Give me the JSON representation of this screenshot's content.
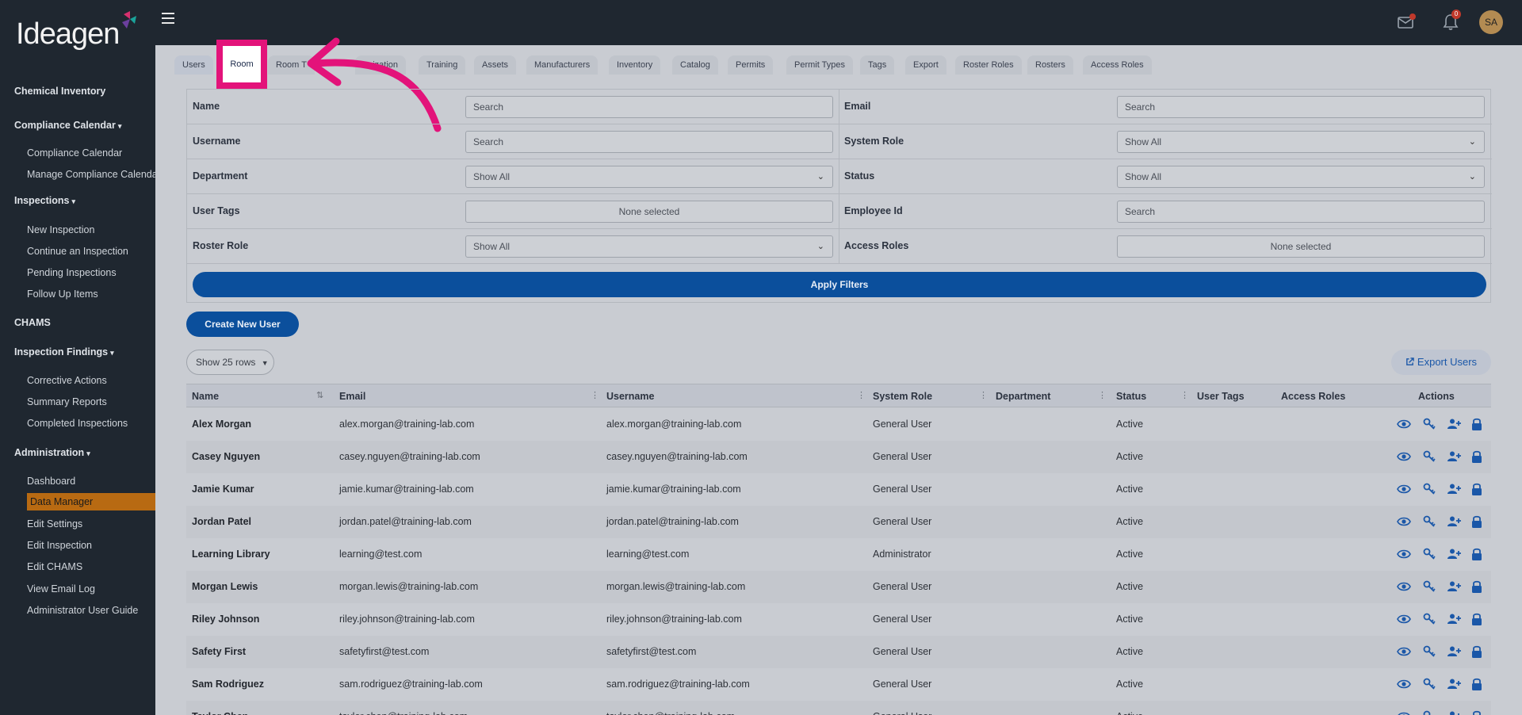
{
  "app": {
    "logo_text": "Ideagen",
    "avatar_initials": "SA",
    "notification_count": "0"
  },
  "sidebar": {
    "items": [
      {
        "label": "Chemical Inventory",
        "type": "section"
      },
      {
        "label": "Compliance Calendar",
        "type": "section",
        "caret": true
      },
      {
        "label": "Compliance Calendar",
        "type": "sub"
      },
      {
        "label": "Manage Compliance Calendar",
        "type": "sub"
      },
      {
        "label": "Inspections",
        "type": "section",
        "caret": true
      },
      {
        "label": "New Inspection",
        "type": "sub"
      },
      {
        "label": "Continue an Inspection",
        "type": "sub"
      },
      {
        "label": "Pending Inspections",
        "type": "sub"
      },
      {
        "label": "Follow Up Items",
        "type": "sub"
      },
      {
        "label": "CHAMS",
        "type": "section"
      },
      {
        "label": "Inspection Findings",
        "type": "section",
        "caret": true
      },
      {
        "label": "Corrective Actions",
        "type": "sub"
      },
      {
        "label": "Summary Reports",
        "type": "sub"
      },
      {
        "label": "Completed Inspections",
        "type": "sub"
      },
      {
        "label": "Administration",
        "type": "section",
        "caret": true
      },
      {
        "label": "Dashboard",
        "type": "sub"
      },
      {
        "label": "Data Manager",
        "type": "active"
      },
      {
        "label": "Edit Settings",
        "type": "sub"
      },
      {
        "label": "Edit Inspection",
        "type": "sub"
      },
      {
        "label": "Edit CHAMS",
        "type": "sub"
      },
      {
        "label": "View Email Log",
        "type": "sub"
      },
      {
        "label": "Administrator User Guide",
        "type": "sub"
      }
    ]
  },
  "tabs": [
    "Users",
    "Room",
    "Room T",
    "anization",
    "Training",
    "Assets",
    "Manufacturers",
    "Inventory",
    "Catalog",
    "Permits",
    "Permit Types",
    "Tags",
    "Export",
    "Roster Roles",
    "Rosters",
    "Access Roles"
  ],
  "filters": {
    "name_label": "Name",
    "name_placeholder": "Search",
    "email_label": "Email",
    "email_placeholder": "Search",
    "username_label": "Username",
    "username_placeholder": "Search",
    "system_role_label": "System Role",
    "system_role_value": "Show All",
    "department_label": "Department",
    "department_value": "Show All",
    "status_label": "Status",
    "status_value": "Show All",
    "user_tags_label": "User Tags",
    "user_tags_value": "None selected",
    "employee_id_label": "Employee Id",
    "employee_id_placeholder": "Search",
    "roster_role_label": "Roster Role",
    "roster_role_value": "Show All",
    "access_roles_label": "Access Roles",
    "access_roles_value": "None selected",
    "apply_label": "Apply Filters"
  },
  "toolbar": {
    "create_label": "Create New User",
    "rows_label": "Show 25 rows",
    "export_label": "Export Users"
  },
  "table": {
    "headers": [
      "Name",
      "Email",
      "Username",
      "System Role",
      "Department",
      "Status",
      "User Tags",
      "Access Roles",
      "Actions"
    ],
    "rows": [
      {
        "name": "Alex Morgan",
        "email": "alex.morgan@training-lab.com",
        "username": "alex.morgan@training-lab.com",
        "role": "General User",
        "status": "Active"
      },
      {
        "name": "Casey Nguyen",
        "email": "casey.nguyen@training-lab.com",
        "username": "casey.nguyen@training-lab.com",
        "role": "General User",
        "status": "Active"
      },
      {
        "name": "Jamie Kumar",
        "email": "jamie.kumar@training-lab.com",
        "username": "jamie.kumar@training-lab.com",
        "role": "General User",
        "status": "Active"
      },
      {
        "name": "Jordan Patel",
        "email": "jordan.patel@training-lab.com",
        "username": "jordan.patel@training-lab.com",
        "role": "General User",
        "status": "Active"
      },
      {
        "name": "Learning Library",
        "email": "learning@test.com",
        "username": "learning@test.com",
        "role": "Administrator",
        "status": "Active"
      },
      {
        "name": "Morgan Lewis",
        "email": "morgan.lewis@training-lab.com",
        "username": "morgan.lewis@training-lab.com",
        "role": "General User",
        "status": "Active"
      },
      {
        "name": "Riley Johnson",
        "email": "riley.johnson@training-lab.com",
        "username": "riley.johnson@training-lab.com",
        "role": "General User",
        "status": "Active"
      },
      {
        "name": "Safety First",
        "email": "safetyfirst@test.com",
        "username": "safetyfirst@test.com",
        "role": "General User",
        "status": "Active"
      },
      {
        "name": "Sam Rodriguez",
        "email": "sam.rodriguez@training-lab.com",
        "username": "sam.rodriguez@training-lab.com",
        "role": "General User",
        "status": "Active"
      },
      {
        "name": "Taylor Chen",
        "email": "taylor.chen@training-lab.com",
        "username": "taylor.chen@training-lab.com",
        "role": "General User",
        "status": "Active"
      }
    ],
    "action_icons": [
      "eye-icon",
      "key-icon",
      "user-plus-icon",
      "lock-icon"
    ]
  },
  "annotation": {
    "highlight_color": "#e3137a",
    "highlighted_tab": "Room"
  }
}
